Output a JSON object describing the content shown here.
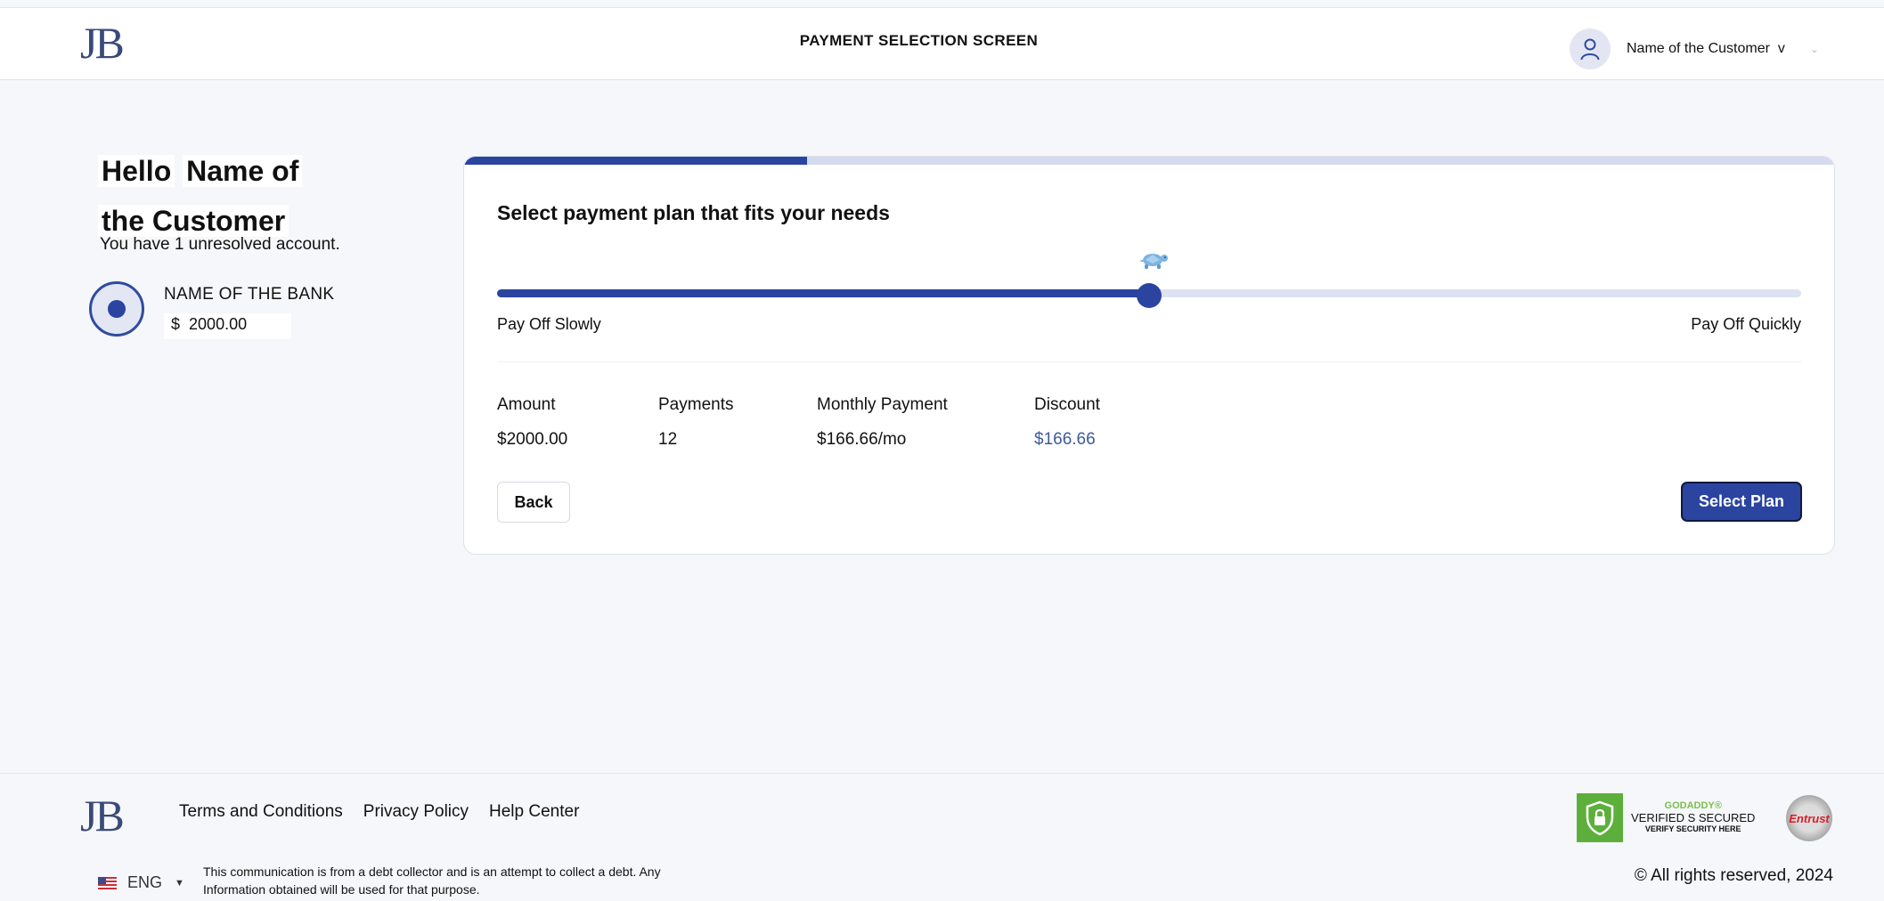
{
  "header": {
    "logo": "JB",
    "title": "PAYMENT SELECTION SCREEN",
    "user_name": "Name of the Customer",
    "user_suffix": "v",
    "user_chevron": "⌄"
  },
  "greeting": {
    "hello": "Hello",
    "name_line1": "Name of",
    "name_line2": "the Customer",
    "unresolved": "You have 1 unresolved account."
  },
  "account": {
    "bank_name": "NAME OF THE BANK",
    "currency": "$",
    "amount": "2000.00",
    "selected": true
  },
  "plan": {
    "progress_fraction": 0.25,
    "title": "Select payment plan that fits your needs",
    "slider_fraction": 0.5,
    "slider_icon": "turtle-icon",
    "label_slow": "Pay Off Slowly",
    "label_fast": "Pay Off Quickly",
    "columns": [
      {
        "header": "Amount",
        "value": "$2000.00"
      },
      {
        "header": "Payments",
        "value": "12"
      },
      {
        "header": "Monthly Payment",
        "value": "$166.66/mo"
      },
      {
        "header": "Discount",
        "value": "$166.66"
      }
    ],
    "back_label": "Back",
    "select_label": "Select Plan"
  },
  "footer": {
    "logo": "JB",
    "links": [
      "Terms and Conditions",
      "Privacy Policy",
      "Help Center"
    ],
    "language": "ENG",
    "disclaimer": "This communication is from a debt collector and is an attempt to collect a debt. Any Information obtained will be used for that purpose.",
    "seal_line1": "GODADDY®",
    "seal_line2": "VERIFIED S SECURED",
    "seal_line3": "VERIFY SECURITY HERE",
    "entrust": "Entrust",
    "copyright": "© All rights reserved, 2024"
  },
  "colors": {
    "primary": "#2a44a0",
    "track": "#dde2f2",
    "discount": "#3d5a9b",
    "background": "#f6f7fa"
  }
}
